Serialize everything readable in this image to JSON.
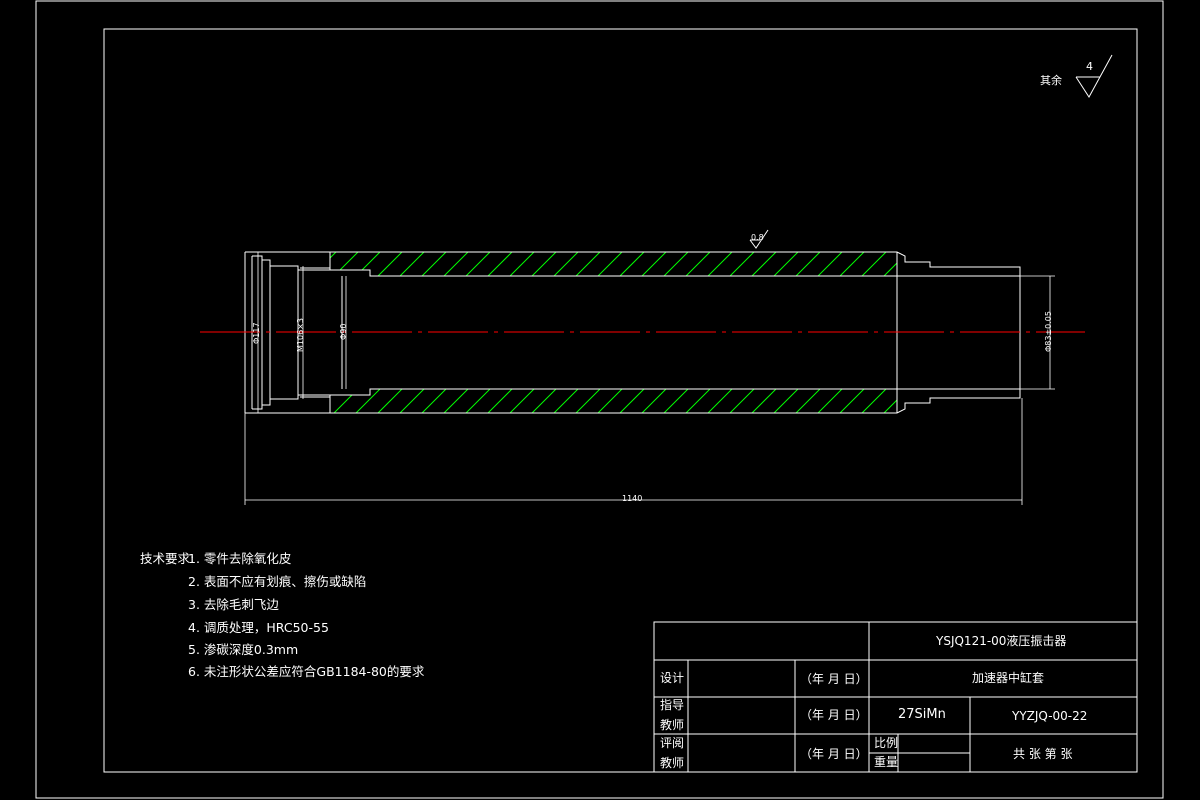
{
  "drawing": {
    "colors": {
      "background": "#000000",
      "line": "#ffffff",
      "hatch": "#00ff00",
      "centerline": "#ff0000"
    },
    "roughness": {
      "label": "其余",
      "value": "4",
      "surface_value": "0.8"
    },
    "dimensions": {
      "outer_dia": "Φ117",
      "thread": "M106×3",
      "bore_dia": "Φ90",
      "end_dia": "Φ83±0.05",
      "length": "1140"
    },
    "tech": {
      "heading": "技术要求:",
      "items": [
        "1.  零件去除氧化皮",
        "2.  表面不应有划痕、擦伤或缺陷",
        "3.  去除毛刺飞边",
        "4.  调质处理，HRC50-55",
        "5.  渗碳深度0.3mm",
        "6.  未注形状公差应符合GB1184-80的要求"
      ]
    },
    "title_block": {
      "project": "YSJQ121-00液压振击器",
      "part_name": "加速器中缸套",
      "material": "27SiMn",
      "drawing_no": "YYZJQ-00-22",
      "design_label": "设计",
      "guide_label_1": "指导",
      "guide_label_2": "教师",
      "review_label_1": "评阅",
      "review_label_2": "教师",
      "date_label": "（年 月 日）",
      "scale_label": "比例",
      "weight_label": "重量",
      "sheet_label": "共  张  第  张"
    }
  }
}
